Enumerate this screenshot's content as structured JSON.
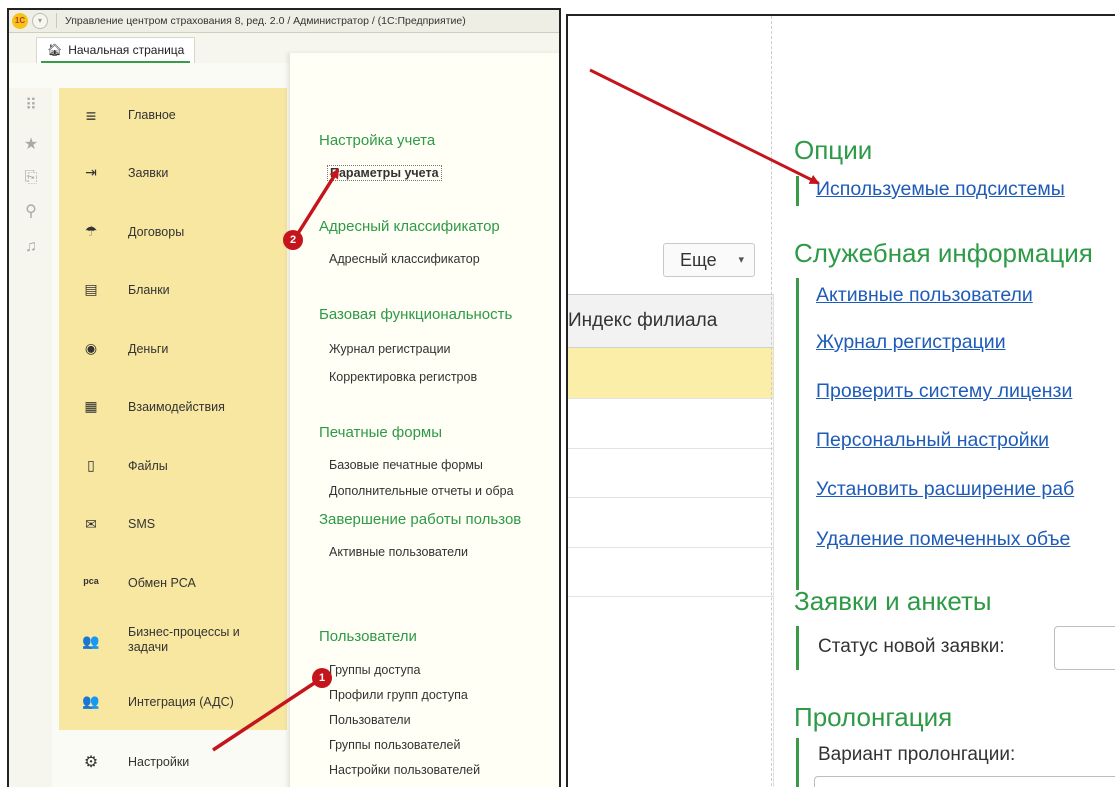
{
  "window": {
    "logo_text": "1C",
    "dropdown_glyph": "▾",
    "title": "Управление центром страхования 8, ред. 2.0 / Администратор /  (1С:Предприятие)"
  },
  "tabs": {
    "home_label": "Начальная страница",
    "home_icon": "home-icon"
  },
  "icon_strip": [
    {
      "name": "apps-grid-icon",
      "glyph": "⠿"
    },
    {
      "name": "favorites-star-icon",
      "glyph": "★"
    },
    {
      "name": "history-icon",
      "glyph": "⎘"
    },
    {
      "name": "search-icon",
      "glyph": "⚲"
    },
    {
      "name": "bell-icon",
      "glyph": "♫"
    }
  ],
  "menu": [
    {
      "label": "Главное",
      "icon": "menu-lines-icon",
      "glyph": "≡"
    },
    {
      "label": "Заявки",
      "icon": "enter-icon",
      "glyph": "⇥"
    },
    {
      "label": "Договоры",
      "icon": "umbrella-icon",
      "glyph": "☂"
    },
    {
      "label": "Бланки",
      "icon": "form-icon",
      "glyph": "▤"
    },
    {
      "label": "Деньги",
      "icon": "coins-icon",
      "glyph": "◉"
    },
    {
      "label": "Взаимодействия",
      "icon": "calendar-icon",
      "glyph": "▦"
    },
    {
      "label": "Файлы",
      "icon": "file-icon",
      "glyph": "▯"
    },
    {
      "label": "SMS",
      "icon": "envelope-icon",
      "glyph": "✉"
    },
    {
      "label": "Обмен РСА",
      "icon": "pca-icon",
      "glyph": "pca"
    },
    {
      "label": "Бизнес-процессы и задачи",
      "icon": "users-icon",
      "glyph": "👥"
    },
    {
      "label": "Интеграция (АДС)",
      "icon": "users-icon",
      "glyph": "👥"
    },
    {
      "label": "Настройки",
      "icon": "gears-icon",
      "glyph": "⚙"
    }
  ],
  "submenu": {
    "sections": [
      {
        "heading": "Настройка учета",
        "items": [
          "Параметры учета"
        ]
      },
      {
        "heading": "Адресный классификатор",
        "items": [
          "Адресный классификатор"
        ]
      },
      {
        "heading": "Базовая функциональность",
        "items": [
          "Журнал регистрации",
          "Корректировка регистров"
        ]
      },
      {
        "heading": "Печатные формы",
        "items": [
          "Базовые печатные формы",
          "Дополнительные отчеты и обра"
        ]
      },
      {
        "heading": "Завершение работы пользов",
        "items": [
          "Активные пользователи"
        ]
      },
      {
        "heading": "Пользователи",
        "items": [
          "Группы доступа",
          "Профили групп доступа",
          "Пользователи",
          "Группы пользователей",
          "Настройки пользователей"
        ]
      }
    ]
  },
  "right": {
    "more_button": "Еще",
    "more_caret": "▾",
    "table_header": "Индекс филиала",
    "sections": [
      {
        "heading": "Опции",
        "links": [
          "Используемые подсистемы"
        ]
      },
      {
        "heading": "Служебная информация",
        "links": [
          "Активные пользователи",
          "Журнал регистрации",
          "Проверить систему лицензи",
          "Персональный настройки",
          "Установить расширение раб",
          "Удаление помеченных объе"
        ]
      },
      {
        "heading": "Заявки и анкеты",
        "field_label": "Статус новой заявки:"
      },
      {
        "heading": "Пролонгация",
        "field_label": "Вариант пролонгации:"
      }
    ]
  },
  "annotations": {
    "badge_1": "1",
    "badge_2": "2",
    "arrow_color": "#c4151c"
  },
  "colors": {
    "menu_bg": "#f7e7a0",
    "heading_green": "#2e9a47",
    "link_blue": "#1f5bb8",
    "selected_row": "#fbeea8"
  }
}
